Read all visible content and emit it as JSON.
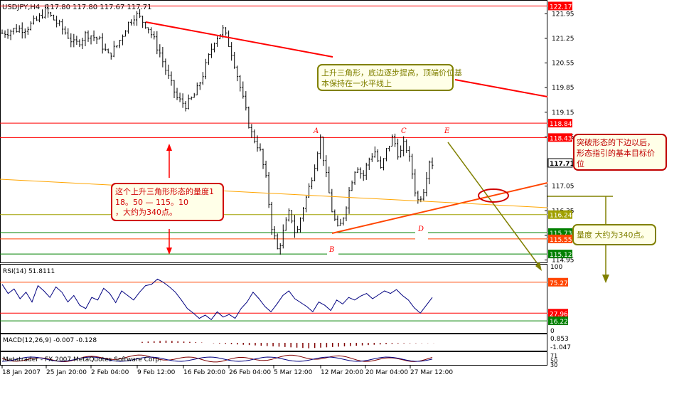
{
  "header": {
    "symbol": "USDJPY,H4",
    "ohlc": "117.80 117.80 117.67 117.71"
  },
  "colors": {
    "background": "#ffffff",
    "candle": "#000000",
    "resistance_line": "#ff0000",
    "support_line": "#ff4500",
    "trend_line": "#ffa500",
    "target_arrow": "#808000",
    "annotation_red": "#d00000",
    "annotation_olive": "#808000",
    "rsi_line": "#000080",
    "level_green": "#008000",
    "level_red": "#ff0000"
  },
  "chart_data": [
    {
      "type": "candlestick",
      "title": "USDJPY,H4",
      "ylim": [
        114.9,
        122.3
      ],
      "price_axis_ticks": [
        "121.95",
        "121.25",
        "120.55",
        "119.85",
        "119.15",
        "118.45",
        "117.05",
        "116.35",
        "115.65",
        "114.95"
      ],
      "time_axis_ticks": [
        "18 Jan 2007",
        "25 Jan 20:00",
        "2 Feb 04:00",
        "9 Feb 12:00",
        "16 Feb 20:00",
        "26 Feb 04:00",
        "5 Mar 12:00",
        "12 Mar 20:00",
        "20 Mar 04:00",
        "27 Mar 12:00"
      ],
      "price_path": [
        [
          0,
          121.4
        ],
        [
          4,
          121.5
        ],
        [
          8,
          121.55
        ],
        [
          12,
          121.8
        ],
        [
          14,
          122.05
        ],
        [
          18,
          121.7
        ],
        [
          22,
          121.3
        ],
        [
          24,
          121.05
        ],
        [
          28,
          121.4
        ],
        [
          32,
          121.2
        ],
        [
          35,
          120.75
        ],
        [
          38,
          121.05
        ],
        [
          41,
          121.6
        ],
        [
          44,
          121.95
        ],
        [
          48,
          121.6
        ],
        [
          52,
          120.85
        ],
        [
          55,
          120.1
        ],
        [
          58,
          119.5
        ],
        [
          61,
          119.35
        ],
        [
          64,
          119.7
        ],
        [
          67,
          120.4
        ],
        [
          70,
          121.2
        ],
        [
          73,
          121.5
        ],
        [
          76,
          120.8
        ],
        [
          79,
          119.7
        ],
        [
          82,
          118.6
        ],
        [
          85,
          118.1
        ],
        [
          87,
          117.3
        ],
        [
          89,
          115.9
        ],
        [
          91,
          115.2
        ],
        [
          93,
          115.8
        ],
        [
          95,
          116.35
        ],
        [
          97,
          115.6
        ],
        [
          99,
          116.35
        ],
        [
          101,
          116.9
        ],
        [
          103,
          117.6
        ],
        [
          105,
          118.45
        ],
        [
          107,
          117.3
        ],
        [
          109,
          116.3
        ],
        [
          111,
          115.75
        ],
        [
          113,
          116.3
        ],
        [
          115,
          117.1
        ],
        [
          117,
          117.7
        ],
        [
          119,
          117.3
        ],
        [
          121,
          117.8
        ],
        [
          123,
          118.05
        ],
        [
          125,
          117.5
        ],
        [
          127,
          118.1
        ],
        [
          129,
          118.45
        ],
        [
          131,
          117.9
        ],
        [
          133,
          118.3
        ],
        [
          135,
          117.6
        ],
        [
          137,
          116.6
        ],
        [
          139,
          116.9
        ],
        [
          141,
          117.8
        ],
        [
          142,
          117.71
        ]
      ],
      "levels": [
        {
          "label": "122.17",
          "value": 122.17,
          "color": "#ff0000"
        },
        {
          "label": "118.84",
          "value": 118.84,
          "color": "#ff0000"
        },
        {
          "label": "118.43",
          "value": 118.43,
          "color": "#ff0000"
        },
        {
          "label": "117.71",
          "value": 117.71,
          "color": "#000000"
        },
        {
          "label": "116.24",
          "value": 116.24,
          "color": "#a0a000"
        },
        {
          "label": "115.73",
          "value": 115.73,
          "color": "#008000"
        },
        {
          "label": "115.55",
          "value": 115.55,
          "color": "#ff4500"
        },
        {
          "label": "115.12",
          "value": 115.12,
          "color": "#008000"
        }
      ],
      "point_labels": [
        "A",
        "B",
        "C",
        "D",
        "E"
      ],
      "annotations": [
        "上升三角形，底边逐步提高，顶端价位基本保持在一水平线上",
        "突破形态的下边以后，形态指引的基本目标价位",
        "这个上升三角形形态的量度118。50 — 115。10，大约为340点。",
        "量度 大约为340点。"
      ]
    },
    {
      "type": "line",
      "title": "RSI(14) 51.8111",
      "ylim": [
        0,
        100
      ],
      "tick_labels": [
        "100",
        "0"
      ],
      "levels": [
        {
          "label": "75.27",
          "value": 75.27,
          "color": "#ff4500"
        },
        {
          "label": "27.96",
          "value": 27.96,
          "color": "#ff0000"
        },
        {
          "label": "16.22",
          "value": 16.22,
          "color": "#008000"
        }
      ],
      "series": [
        {
          "values": [
            72,
            58,
            65,
            50,
            60,
            45,
            70,
            62,
            52,
            68,
            60,
            45,
            55,
            40,
            35,
            52,
            48,
            66,
            58,
            44,
            62,
            55,
            48,
            60,
            70,
            72,
            80,
            75,
            68,
            60,
            48,
            35,
            28,
            20,
            25,
            18,
            30,
            22,
            26,
            20,
            35,
            45,
            60,
            50,
            38,
            30,
            42,
            55,
            62,
            50,
            44,
            38,
            30,
            45,
            40,
            32,
            48,
            42,
            52,
            48,
            54,
            58,
            50,
            56,
            62,
            58,
            64,
            55,
            48,
            36,
            28,
            40,
            52
          ]
        }
      ]
    },
    {
      "type": "bar",
      "title": "MACD(12,26,9) -0.007 -0.128",
      "tick_labels": [
        "0.853",
        "-1.047"
      ],
      "values": [
        0.15,
        0.2,
        0.25,
        0.3,
        0.35,
        0.3,
        0.25,
        0.2,
        0.15,
        0.1,
        0.05,
        0.0,
        -0.05,
        -0.1,
        -0.15,
        -0.2,
        -0.25,
        -0.3,
        -0.35,
        -0.4,
        -0.45,
        -0.5,
        -0.55,
        -0.6,
        -0.65,
        -0.7,
        -0.75,
        -0.8,
        -0.85,
        -0.8,
        -0.75,
        -0.7,
        -0.65,
        -0.6,
        -0.55,
        -0.5,
        -0.45,
        -0.4,
        -0.35,
        -0.3,
        -0.25,
        -0.2,
        -0.15,
        -0.1,
        -0.08,
        -0.06,
        -0.05,
        -0.04,
        -0.03,
        -0.02
      ]
    }
  ],
  "bottom_panel": {
    "text": "Metatrader - FX 2007 MetaQuotes Software Corp.",
    "tick_labels": [
      "71",
      "50",
      "30"
    ]
  }
}
